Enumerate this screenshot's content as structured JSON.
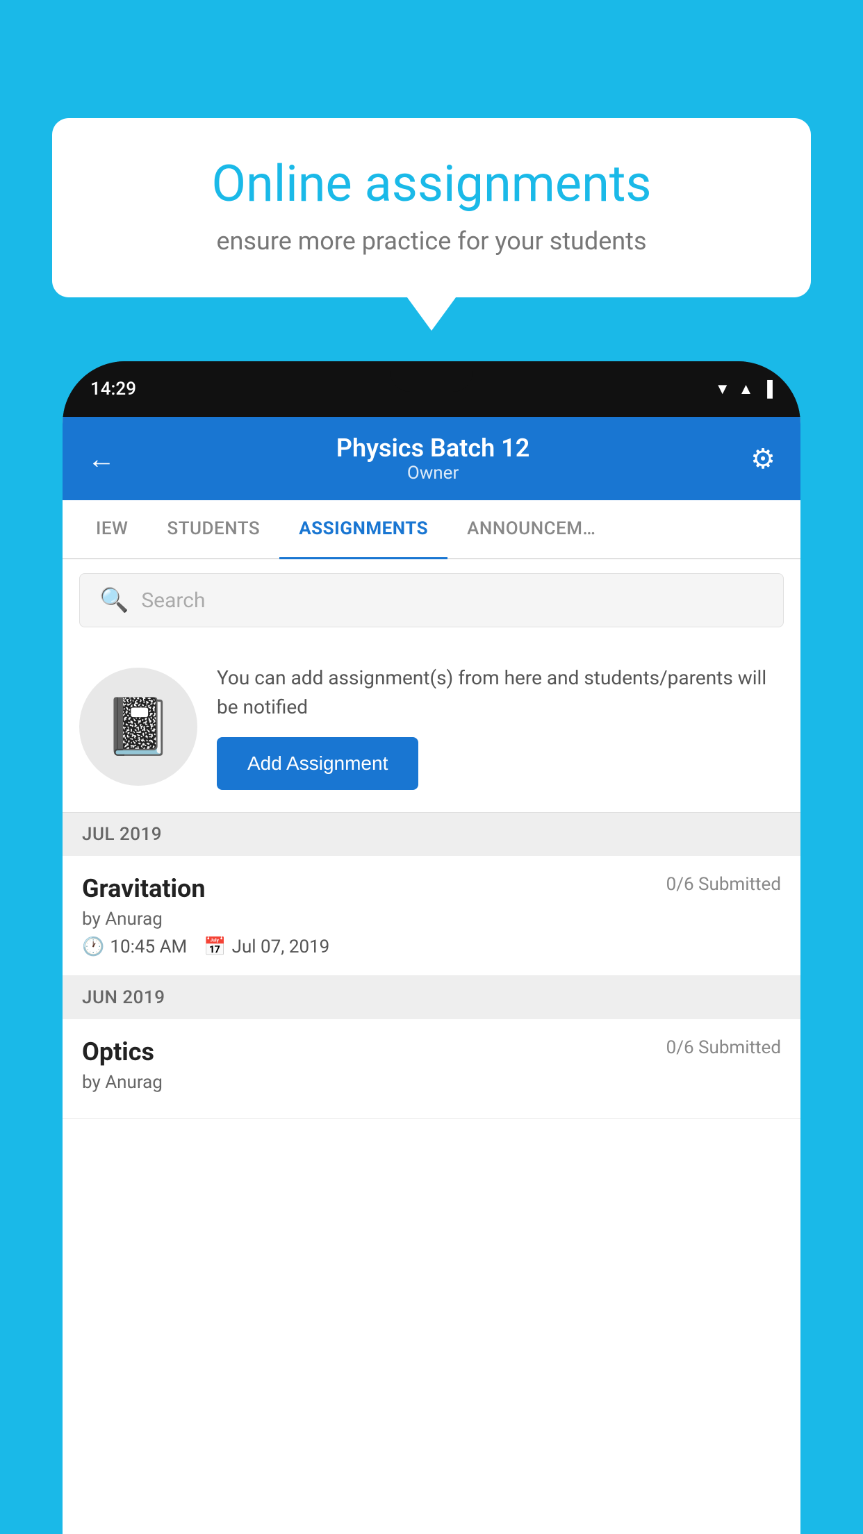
{
  "background_color": "#1ab9e8",
  "speech_bubble": {
    "title": "Online assignments",
    "subtitle": "ensure more practice for your students"
  },
  "phone": {
    "status_bar": {
      "time": "14:29"
    },
    "header": {
      "title": "Physics Batch 12",
      "subtitle": "Owner",
      "back_label": "←",
      "gear_label": "⚙"
    },
    "tabs": [
      {
        "label": "IEW",
        "active": false
      },
      {
        "label": "STUDENTS",
        "active": false
      },
      {
        "label": "ASSIGNMENTS",
        "active": true
      },
      {
        "label": "ANNOUNCEM…",
        "active": false
      }
    ],
    "search": {
      "placeholder": "Search"
    },
    "add_assignment_section": {
      "description_text": "You can add assignment(s) from here and students/parents will be notified",
      "button_label": "Add Assignment"
    },
    "sections": [
      {
        "month_label": "JUL 2019",
        "assignments": [
          {
            "name": "Gravitation",
            "submitted": "0/6 Submitted",
            "by": "by Anurag",
            "time": "10:45 AM",
            "date": "Jul 07, 2019"
          }
        ]
      },
      {
        "month_label": "JUN 2019",
        "assignments": [
          {
            "name": "Optics",
            "submitted": "0/6 Submitted",
            "by": "by Anurag",
            "time": "",
            "date": ""
          }
        ]
      }
    ]
  }
}
